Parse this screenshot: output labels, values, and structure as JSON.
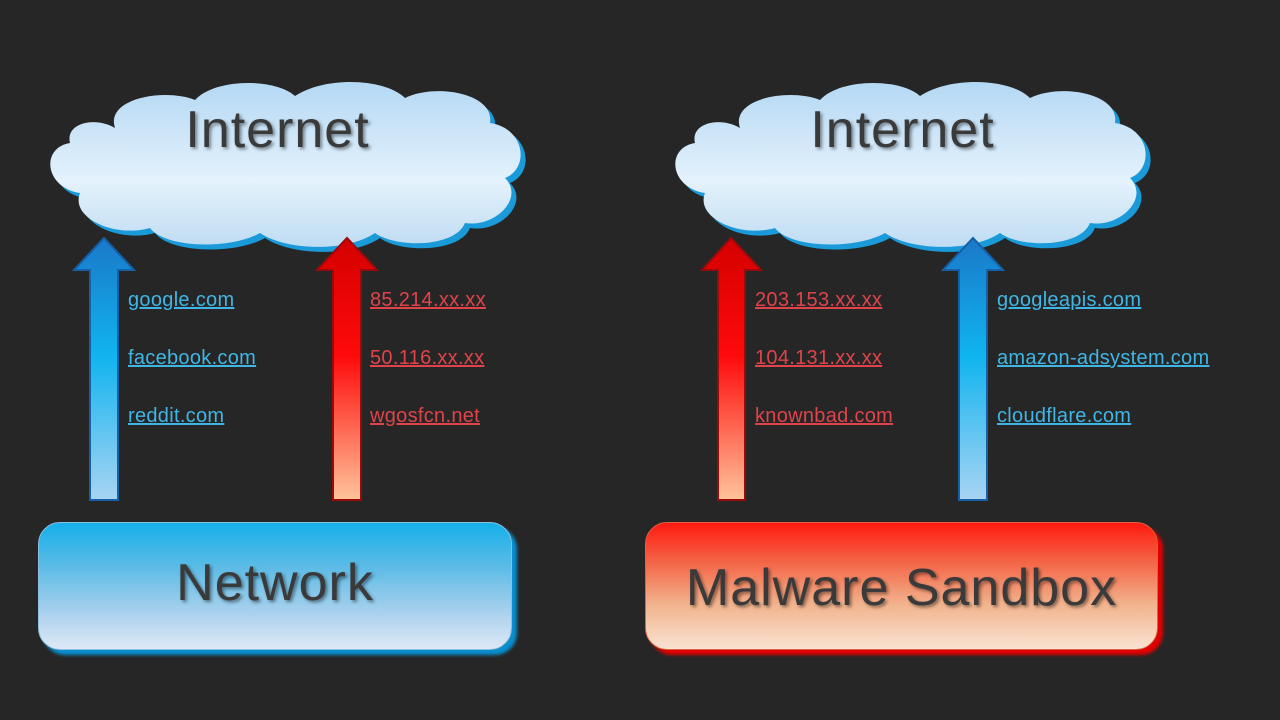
{
  "colors": {
    "background": "#262626",
    "safe_blue": "#3fb6e6",
    "malicious_red": "#e0434a"
  },
  "left_panel": {
    "cloud_label": "Internet",
    "box_label": "Network",
    "safe_arrow": {
      "color": "blue",
      "links": [
        "google.com",
        "facebook.com",
        "reddit.com"
      ]
    },
    "bad_arrow": {
      "color": "red",
      "links": [
        "85.214.xx.xx",
        "50.116.xx.xx",
        "wgosfcn.net"
      ]
    }
  },
  "right_panel": {
    "cloud_label": "Internet",
    "box_label": "Malware Sandbox",
    "bad_arrow": {
      "color": "red",
      "links": [
        "203.153.xx.xx",
        "104.131.xx.xx",
        "knownbad.com"
      ]
    },
    "safe_arrow": {
      "color": "blue",
      "links": [
        "googleapis.com",
        "amazon-adsystem.com",
        "cloudflare.com"
      ]
    }
  }
}
